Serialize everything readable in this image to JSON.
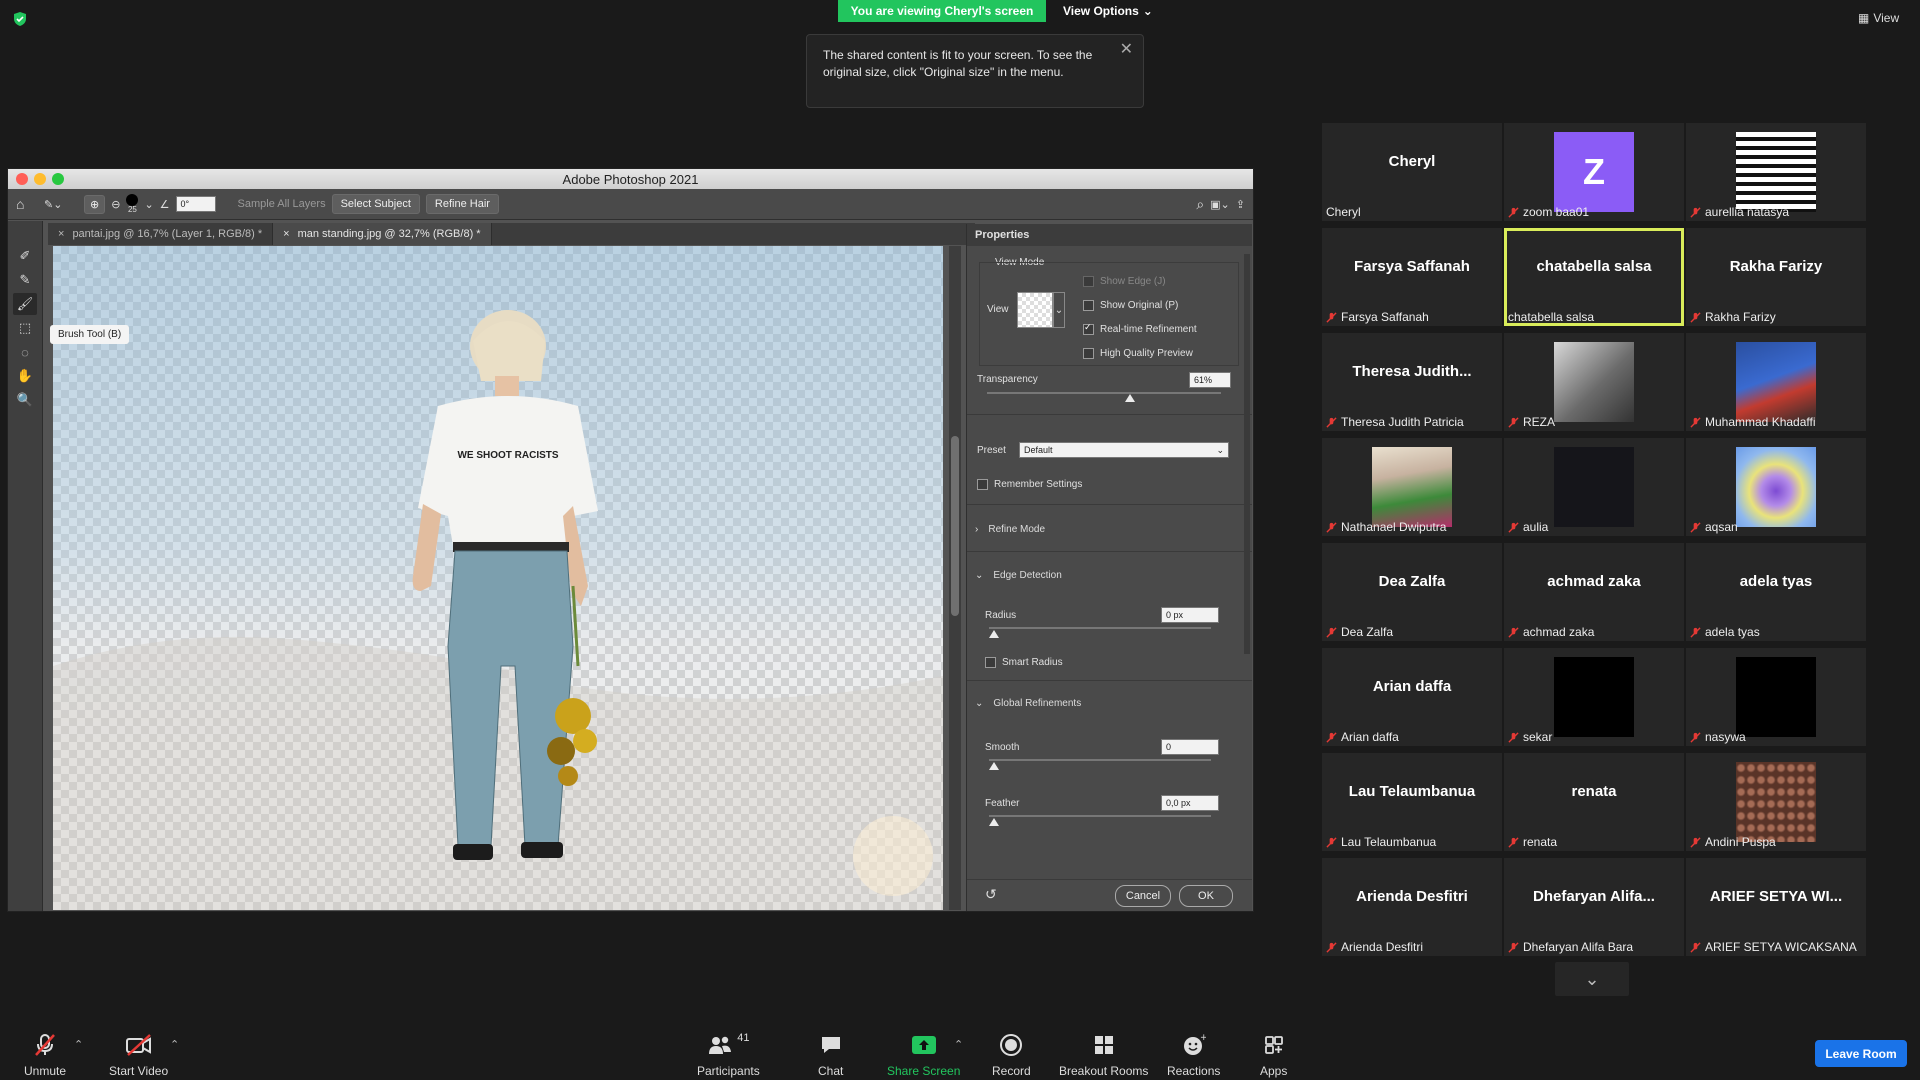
{
  "zoom": {
    "banner": "You are viewing Cheryl's screen",
    "view_options": "View Options",
    "view": "View",
    "notice": "The shared content is fit to your screen. To see the original size, click \"Original size\" in the menu.",
    "colors": {
      "green": "#22c55e",
      "blue": "#1a73e8",
      "highlight": "#d9ec5a"
    }
  },
  "photoshop": {
    "title": "Adobe Photoshop 2021",
    "options": {
      "brush_size": "25",
      "angle": "0°",
      "sample_all_layers": "Sample All Layers",
      "select_subject": "Select Subject",
      "refine_hair": "Refine Hair"
    },
    "tabs": [
      {
        "label": "pantai.jpg @ 16,7% (Layer 1, RGB/8) *"
      },
      {
        "label": "man standing.jpg @ 32,7% (RGB/8) *"
      }
    ],
    "tooltip": "Brush Tool (B)",
    "artwork_text": "WE SHOOT RACISTS",
    "properties": {
      "title": "Properties",
      "view_mode": "View Mode",
      "view": "View",
      "show_edge": "Show Edge (J)",
      "show_original": "Show Original (P)",
      "realtime": "Real-time Refinement",
      "hq_preview": "High Quality Preview",
      "transparency": "Transparency",
      "transparency_value": "61%",
      "preset": "Preset",
      "preset_value": "Default",
      "remember": "Remember Settings",
      "refine_mode": "Refine Mode",
      "edge_detection": "Edge Detection",
      "radius": "Radius",
      "radius_value": "0 px",
      "smart_radius": "Smart Radius",
      "global_refinements": "Global Refinements",
      "smooth": "Smooth",
      "smooth_value": "0",
      "feather": "Feather",
      "feather_value": "0,0 px",
      "cancel": "Cancel",
      "ok": "OK"
    }
  },
  "participants": [
    {
      "name": "Cheryl",
      "label": "Cheryl",
      "muted": false,
      "kind": "name"
    },
    {
      "name": "Z",
      "label": "zoom baa01",
      "muted": true,
      "kind": "avatar"
    },
    {
      "name": "",
      "label": "aurellia natasya",
      "muted": true,
      "kind": "stripes"
    },
    {
      "name": "Farsya Saffanah",
      "label": "Farsya Saffanah",
      "muted": true,
      "kind": "name"
    },
    {
      "name": "chatabella salsa",
      "label": "chatabella salsa",
      "muted": false,
      "kind": "name",
      "active": true
    },
    {
      "name": "Rakha Farizy",
      "label": "Rakha Farizy",
      "muted": true,
      "kind": "name"
    },
    {
      "name": "Theresa Judith...",
      "label": "Theresa Judith Patricia",
      "muted": true,
      "kind": "name"
    },
    {
      "name": "",
      "label": "REZA",
      "muted": true,
      "kind": "photo-bw"
    },
    {
      "name": "",
      "label": "Muhammad Khadaffi",
      "muted": true,
      "kind": "photo-sport"
    },
    {
      "name": "",
      "label": "Nathanael Dwiputra",
      "muted": true,
      "kind": "photo-color"
    },
    {
      "name": "",
      "label": "aulia",
      "muted": true,
      "kind": "dark"
    },
    {
      "name": "",
      "label": "aqsan",
      "muted": true,
      "kind": "heart"
    },
    {
      "name": "Dea Zalfa",
      "label": "Dea Zalfa",
      "muted": true,
      "kind": "name"
    },
    {
      "name": "achmad zaka",
      "label": "achmad zaka",
      "muted": true,
      "kind": "name"
    },
    {
      "name": "adela tyas",
      "label": "adela tyas",
      "muted": true,
      "kind": "name"
    },
    {
      "name": "Arian daffa",
      "label": "Arian daffa",
      "muted": true,
      "kind": "name"
    },
    {
      "name": "",
      "label": "sekar",
      "muted": true,
      "kind": "black"
    },
    {
      "name": "",
      "label": "nasywa",
      "muted": true,
      "kind": "black"
    },
    {
      "name": "Lau Telaumbanua",
      "label": "Lau Telaumbanua",
      "muted": true,
      "kind": "name"
    },
    {
      "name": "renata",
      "label": "renata",
      "muted": true,
      "kind": "name"
    },
    {
      "name": "",
      "label": "Andini Puspa",
      "muted": true,
      "kind": "pattern"
    },
    {
      "name": "Arienda Desfitri",
      "label": "Arienda Desfitri",
      "muted": true,
      "kind": "name"
    },
    {
      "name": "Dhefaryan Alifa...",
      "label": "Dhefaryan Alifa Bara",
      "muted": true,
      "kind": "name"
    },
    {
      "name": "ARIEF SETYA WI...",
      "label": "ARIEF SETYA WICAKSANA",
      "muted": true,
      "kind": "name"
    }
  ],
  "toolbar": {
    "unmute": "Unmute",
    "start_video": "Start Video",
    "participants": "Participants",
    "participants_count": "41",
    "chat": "Chat",
    "share_screen": "Share Screen",
    "record": "Record",
    "breakout_rooms": "Breakout Rooms",
    "reactions": "Reactions",
    "apps": "Apps",
    "leave_room": "Leave Room"
  }
}
